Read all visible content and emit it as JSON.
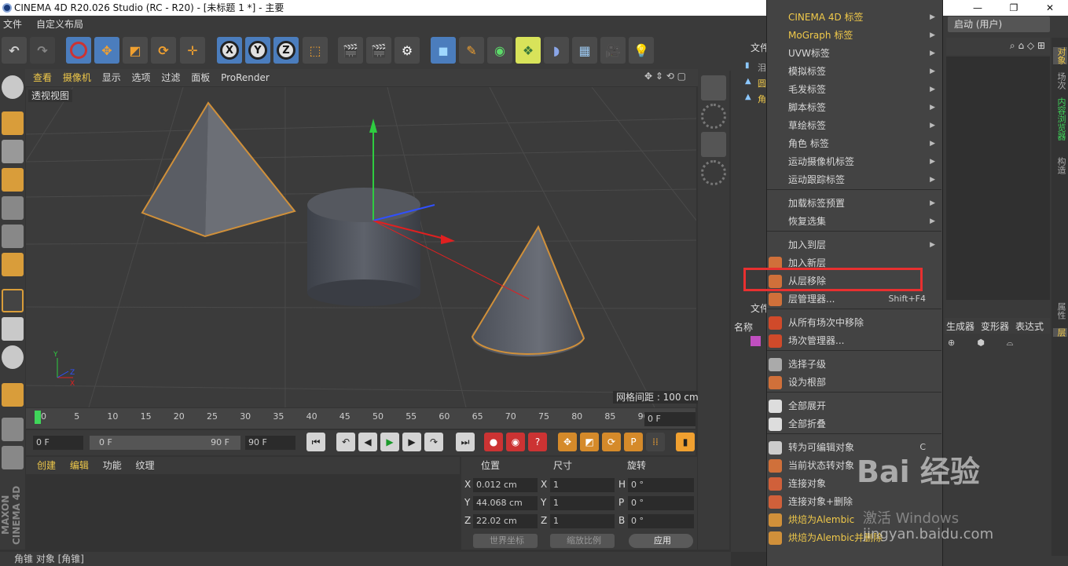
{
  "window": {
    "title": "CINEMA 4D R20.026 Studio (RC - R20) - [未标题 1 *] - 主要",
    "controls": [
      "—",
      "❐",
      "✕"
    ]
  },
  "menubar": {
    "items": [
      "文件",
      "自定义布局"
    ]
  },
  "viewport": {
    "menu": [
      "查看",
      "摄像机",
      "显示",
      "选项",
      "过滤",
      "面板",
      "ProRender"
    ],
    "label": "透视视图",
    "grid_spacing": "网格间距 : 100 cm"
  },
  "timeline": {
    "ticks": [
      "0",
      "5",
      "10",
      "15",
      "20",
      "25",
      "30",
      "35",
      "40",
      "45",
      "50",
      "55",
      "60",
      "65",
      "70",
      "75",
      "80",
      "85",
      "90"
    ],
    "current_frame": "0 F",
    "start_frame": "0 F",
    "range_start": "0 F",
    "range_end": "90 F",
    "end_frame": "90 F"
  },
  "material_panel": {
    "menu": [
      "创建",
      "编辑",
      "功能",
      "纹理"
    ]
  },
  "coordinates": {
    "headers": [
      "位置",
      "尺寸",
      "旋转"
    ],
    "pos": [
      {
        "axis": "X",
        "value": "0.012 cm"
      },
      {
        "axis": "Y",
        "value": "44.068 cm"
      },
      {
        "axis": "Z",
        "value": "22.02 cm"
      }
    ],
    "size": [
      {
        "axis": "X",
        "value": "1"
      },
      {
        "axis": "Y",
        "value": "1"
      },
      {
        "axis": "Z",
        "value": "1"
      }
    ],
    "rot": [
      {
        "axis": "H",
        "value": "0 °"
      },
      {
        "axis": "P",
        "value": "0 °"
      },
      {
        "axis": "B",
        "value": "0 °"
      }
    ],
    "world_coords": "世界坐标",
    "scale_ratio": "缩放比例",
    "apply": "应用"
  },
  "status_bar": "角锥 对象 [角锥]",
  "object_panel": {
    "tab": "文件",
    "items": [
      "泪",
      "圆",
      "角"
    ]
  },
  "layer_panel": {
    "tab": "文件",
    "name_col": "名称"
  },
  "right_panel": {
    "startup": "启动 (用户)",
    "columns": [
      "生成器",
      "变形器",
      "表达式"
    ],
    "vertical_tabs": [
      "对象",
      "场次",
      "内容浏览器",
      "构造",
      "属性",
      "层"
    ]
  },
  "context_menu": {
    "items": [
      {
        "label": "CINEMA 4D 标签",
        "submenu": true,
        "yellow": true
      },
      {
        "label": "MoGraph 标签",
        "submenu": true,
        "yellow": true
      },
      {
        "label": "UVW标签",
        "submenu": true
      },
      {
        "label": "模拟标签",
        "submenu": true
      },
      {
        "label": "毛发标签",
        "submenu": true
      },
      {
        "label": "脚本标签",
        "submenu": true
      },
      {
        "label": "草绘标签",
        "submenu": true
      },
      {
        "label": "角色 标签",
        "submenu": true
      },
      {
        "label": "运动摄像机标签",
        "submenu": true
      },
      {
        "label": "运动跟踪标签",
        "submenu": true
      },
      {
        "label": "加载标签预置",
        "submenu": true
      },
      {
        "label": "恢复选集",
        "submenu": true
      },
      {
        "label": "加入到层",
        "submenu": true
      },
      {
        "label": "加入新层"
      },
      {
        "label": "从层移除"
      },
      {
        "label": "层管理器...",
        "shortcut": "Shift+F4"
      },
      {
        "label": "从所有场次中移除"
      },
      {
        "label": "场次管理器..."
      },
      {
        "label": "选择子级"
      },
      {
        "label": "设为根部"
      },
      {
        "label": "全部展开"
      },
      {
        "label": "全部折叠"
      },
      {
        "label": "转为可编辑对象",
        "shortcut": "C"
      },
      {
        "label": "当前状态转对象"
      },
      {
        "label": "连接对象"
      },
      {
        "label": "连接对象+删除"
      },
      {
        "label": "烘焙为Alembic",
        "yellow": true
      },
      {
        "label": "烘焙为Alembic并删除",
        "yellow": true
      }
    ],
    "highlight_color": "#e83030"
  },
  "watermark": {
    "brand": "Bai 经验",
    "activation": "激活 Windows",
    "url": "jingyan.baidu.com"
  },
  "colors": {
    "accent_yellow": "#f0c94a",
    "selection_blue": "#4b7dbd",
    "object_orange": "#d0903a"
  }
}
